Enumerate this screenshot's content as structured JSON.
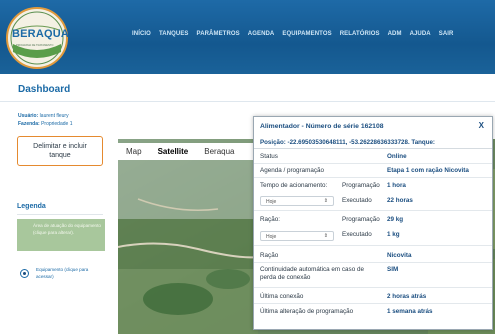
{
  "brand": {
    "name": "BERAQUA",
    "sub": "PROGRAMA DE TRATAMENTO"
  },
  "nav": [
    "INÍCIO",
    "TANQUES",
    "PARÂMETROS",
    "AGENDA",
    "EQUIPAMENTOS",
    "RELATÓRIOS",
    "ADM",
    "AJUDA",
    "SAIR"
  ],
  "page_title": "Dashboard",
  "user": {
    "user_label": "Usuário:",
    "user_value": "laurent fleury",
    "farm_label": "Fazenda:",
    "farm_value": "Propriedade 1"
  },
  "delimit_button": "Delimitar e incluir tanque",
  "legend": {
    "title": "Legenda",
    "area_text": "Área de atuação do equipamento (clique para alterar).",
    "equipment_text": "Equipamento (clique para acessar)"
  },
  "map": {
    "tabs": [
      "Map",
      "Satellite",
      "Beraqua"
    ],
    "selected": "Satellite"
  },
  "popup": {
    "title": "Alimentador - Número de série 162108",
    "close": "X",
    "position": "Posição: -22.69503530648111, -53.26228636333728. Tanque:",
    "status_label": "Status",
    "status_value": "Online",
    "agenda_label": "Agenda / programação",
    "agenda_value": "Etapa 1 com ração Nicovita",
    "tempo_label": "Tempo de acionamento:",
    "programacao_label": "Programação",
    "tempo_prog_value": "1 hora",
    "period_select": "Hoje",
    "executado_label": "Executado",
    "tempo_exec_value": "22 horas",
    "racao_label": "Ração:",
    "racao_prog_value": "29 kg",
    "racao_period_select": "Hoje",
    "racao_exec_value": "1 kg",
    "racao_name_label": "Ração",
    "racao_name_value": "Nicovita",
    "continuidade_label": "Continuidade automática em caso de perda de conexão",
    "continuidade_value": "SIM",
    "ultima_conexao_label": "Última conexão",
    "ultima_conexao_value": "2 horas atrás",
    "ultima_alteracao_label": "Última alteração de programação",
    "ultima_alteracao_value": "1 semana atrás"
  },
  "colors": {
    "brand_blue": "#1b6aa6",
    "accent_orange": "#e58a2f",
    "header_blue": "#14588f"
  }
}
